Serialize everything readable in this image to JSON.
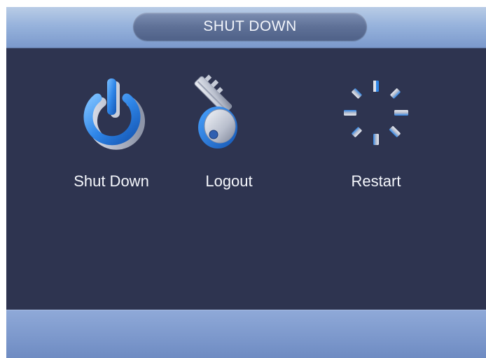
{
  "dialog": {
    "title": "SHUT DOWN"
  },
  "options": {
    "shutdown": {
      "label": "Shut Down",
      "icon": "power-icon"
    },
    "logout": {
      "label": "Logout",
      "icon": "key-icon"
    },
    "restart": {
      "label": "Restart",
      "icon": "restart-spinner-icon"
    }
  },
  "colors": {
    "background": "#2e3450",
    "titlebar": "#97b3dc",
    "accent": "#2f86e8",
    "footer": "#7b97cb"
  }
}
